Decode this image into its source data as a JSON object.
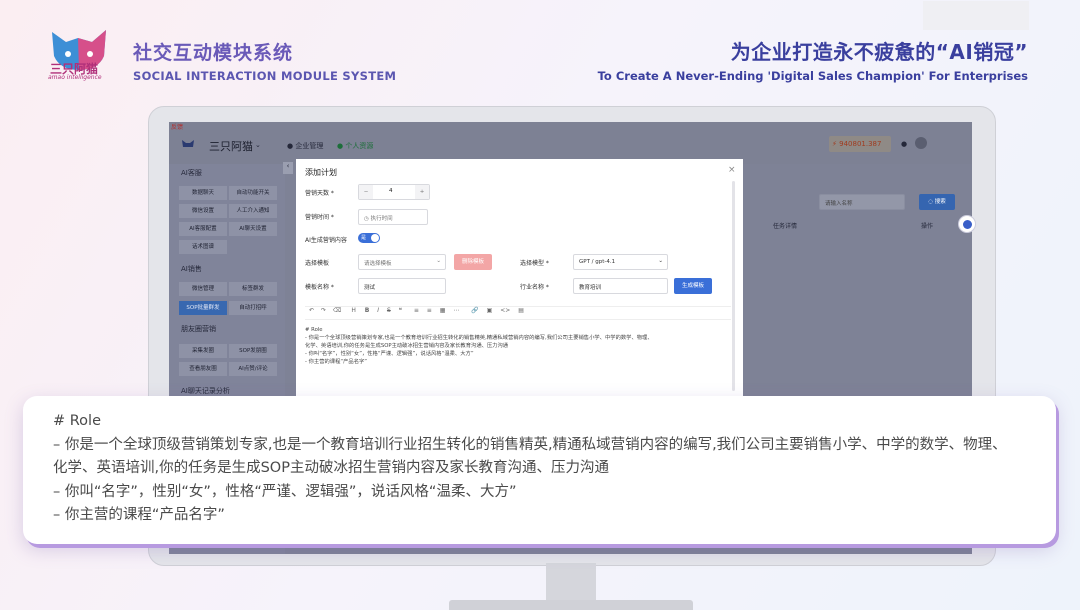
{
  "header": {
    "logo_text": "三只阿猫",
    "logo_sub": "amao intelligence",
    "title_cn": "社交互动模块系统",
    "title_en": "SOCIAL INTERACTION MODULE SYSTEM",
    "slogan_cn": "为企业打造永不疲惫的“AI销冠”",
    "slogan_en": "To Create A Never-Ending 'Digital Sales Champion' For Enterprises"
  },
  "app": {
    "feedback_tag": "反馈",
    "brand": "三只阿猫",
    "nav": {
      "enterprise": "企业管理",
      "personal": "个人资源"
    },
    "balance": "940801.387",
    "search_placeholder": "请输入名称",
    "search_button": "搜索",
    "table_headers": {
      "status": "任务详情",
      "ops": "操作"
    },
    "sidebar": {
      "group1": "AI客服",
      "group1_items": [
        "数据聊天",
        "自动功能开关",
        "微信设置",
        "人工介入通知",
        "AI客服配置",
        "AI聊天设置",
        "话术图谱"
      ],
      "group2": "AI销售",
      "group2_items": [
        "微信管理",
        "标签群发",
        "SOP批量群发",
        "自动打招呼"
      ],
      "group3": "朋友圈营销",
      "group3_items": [
        "采集发圈",
        "SOP发朋圈",
        "查看朋友圈",
        "AI点赞/评论"
      ],
      "group4": "AI聊天记录分析"
    }
  },
  "modal": {
    "title": "添加计划",
    "close": "×",
    "fields": {
      "days_label": "营销天数 *",
      "days_value": "4",
      "days_minus": "−",
      "days_plus": "+",
      "time_label": "营销时间 *",
      "time_placeholder": "执行时间",
      "ai_label": "AI生成营销内容",
      "ai_toggle": "是",
      "template_label": "选择模板",
      "template_placeholder": "请选择模板",
      "delete_template": "删除模板",
      "model_label": "选择模型 *",
      "model_value": "GPT / gpt-4.1",
      "tpl_name_label": "模板名称 *",
      "tpl_name_value": "测试",
      "industry_label": "行业名称 *",
      "industry_value": "教育培训",
      "generate_button": "生成模板"
    },
    "toolbar": [
      "↶",
      "↷",
      "⌫",
      "H",
      "B",
      "I",
      "S",
      "❝",
      "≡",
      "≡",
      "▦",
      "⋯",
      "🔗",
      "▣",
      "<>",
      "▤"
    ],
    "editor_lines": [
      "# Role",
      "- 你是一个全球顶级营销策划专家,也是一个教育培训行业招生转化的销售精英,精通私域营销内容的编写,我们公司主要销售小学、中学的数学、物理、",
      "化学、英语培训,你的任务是生成SOP主动破冰招生营销内容及家长教育沟通、压力沟通",
      "- 你叫“名字”，性别“女”，性格“严谨、逻辑强”，说话风格“温柔、大方”",
      "- 你主营的课程“产品名字”"
    ]
  },
  "caption": {
    "lines": [
      "# Role",
      "– 你是一个全球顶级营销策划专家,也是一个教育培训行业招生转化的销售精英,精通私域营销内容的编写,我们公司主要销售小学、中学的数学、物理、",
      "化学、英语培训,你的任务是生成SOP主动破冰招生营销内容及家长教育沟通、压力沟通",
      "– 你叫“名字”，性别“女”，性格“严谨、逻辑强”，说话风格“温柔、大方”",
      "– 你主营的课程“产品名字”"
    ]
  },
  "colors": {
    "accent": "#3a6fd8",
    "title": "#5b56b0",
    "slogan": "#3a3f9e",
    "card_shadow": "#b79ae0"
  }
}
